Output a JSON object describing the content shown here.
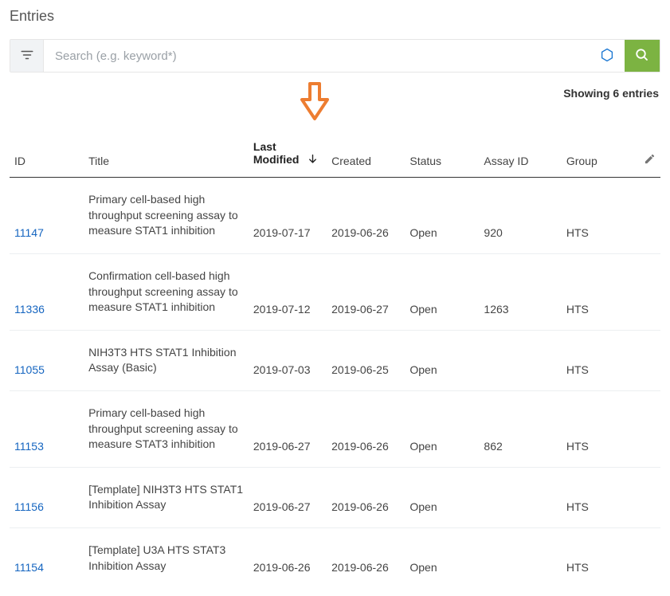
{
  "page_title": "Entries",
  "search": {
    "placeholder": "Search (e.g. keyword*)"
  },
  "showing_text": "Showing 6 entries",
  "columns": {
    "id": "ID",
    "title": "Title",
    "last_modified": "Last Modified",
    "created": "Created",
    "status": "Status",
    "assay_id": "Assay ID",
    "group": "Group"
  },
  "rows": [
    {
      "id": "11147",
      "title": "Primary cell-based high throughput screening assay to measure STAT1 inhibition",
      "last_modified": "2019-07-17",
      "created": "2019-06-26",
      "status": "Open",
      "assay_id": "920",
      "group": "HTS"
    },
    {
      "id": "11336",
      "title": "Confirmation cell-based high throughput screening assay to measure STAT1 inhibition",
      "last_modified": "2019-07-12",
      "created": "2019-06-27",
      "status": "Open",
      "assay_id": "1263",
      "group": "HTS"
    },
    {
      "id": "11055",
      "title": "NIH3T3 HTS STAT1 Inhibition Assay (Basic)",
      "last_modified": "2019-07-03",
      "created": "2019-06-25",
      "status": "Open",
      "assay_id": "",
      "group": "HTS"
    },
    {
      "id": "11153",
      "title": "Primary cell-based high throughput screening assay to measure STAT3 inhibition",
      "last_modified": "2019-06-27",
      "created": "2019-06-26",
      "status": "Open",
      "assay_id": "862",
      "group": "HTS"
    },
    {
      "id": "11156",
      "title": "[Template] NIH3T3 HTS STAT1 Inhibition Assay",
      "last_modified": "2019-06-27",
      "created": "2019-06-26",
      "status": "Open",
      "assay_id": "",
      "group": "HTS"
    },
    {
      "id": "11154",
      "title": "[Template] U3A HTS STAT3 Inhibition Assay",
      "last_modified": "2019-06-26",
      "created": "2019-06-26",
      "status": "Open",
      "assay_id": "",
      "group": "HTS"
    }
  ]
}
